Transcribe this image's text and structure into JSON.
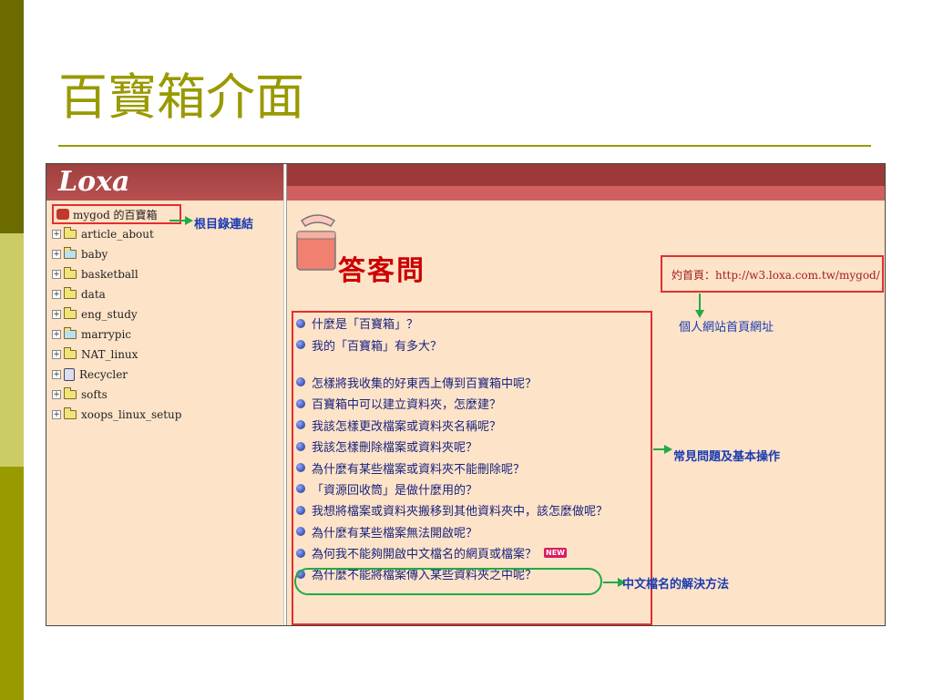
{
  "slide": {
    "title": "百寶箱介面"
  },
  "app": {
    "logo": "Loxa"
  },
  "tree": {
    "root": "mygod 的百寶箱",
    "items": [
      {
        "label": "article_about",
        "icon": "folder-icon"
      },
      {
        "label": "baby",
        "icon": "shared-folder-icon"
      },
      {
        "label": "basketball",
        "icon": "folder-icon"
      },
      {
        "label": "data",
        "icon": "folder-icon"
      },
      {
        "label": "eng_study",
        "icon": "folder-icon"
      },
      {
        "label": "marrypic",
        "icon": "shared-folder-icon"
      },
      {
        "label": "NAT_linux",
        "icon": "folder-icon"
      },
      {
        "label": "Recycler",
        "icon": "recycle-bin-icon"
      },
      {
        "label": "softs",
        "icon": "folder-icon"
      },
      {
        "label": "xoops_linux_setup",
        "icon": "folder-icon"
      }
    ]
  },
  "faq": {
    "title": "答客問",
    "homepage": "妁首頁：http://w3.loxa.com.tw/mygod/",
    "questions": [
      "什麼是「百寶箱」？",
      "我的「百寶箱」有多大？",
      "怎樣將我收集的好東西上傳到百寶箱中呢？",
      "百寶箱中可以建立資料夾，怎麼建？",
      "我該怎樣更改檔案或資料夾名稱呢？",
      "我該怎樣刪除檔案或資料夾呢？",
      "為什麼有某些檔案或資料夾不能刪除呢？",
      "「資源回收筒」是做什麼用的？",
      "我想將檔案或資料夾搬移到其他資料夾中，該怎麼做呢？",
      "為什麼有某些檔案無法開啟呢？",
      "為何我不能夠開啟中文檔名的網頁或檔案？",
      "為什麼不能將檔案傳入某些資料夾之中呢？"
    ],
    "new_badge": "NEW"
  },
  "annotations": {
    "root_link": "根目錄連結",
    "personal_homepage": "個人網站首頁網址",
    "faq_basic": "常見問題及基本操作",
    "chinese_filename": "中文檔名的解決方法"
  },
  "colors": {
    "accent": "#999900",
    "header_bar": "#9c3a3a",
    "pane_bg": "#fde3c8",
    "annotation_text": "#1a3bb0",
    "highlight_red": "#e03030",
    "arrow_green": "#22aa44"
  }
}
